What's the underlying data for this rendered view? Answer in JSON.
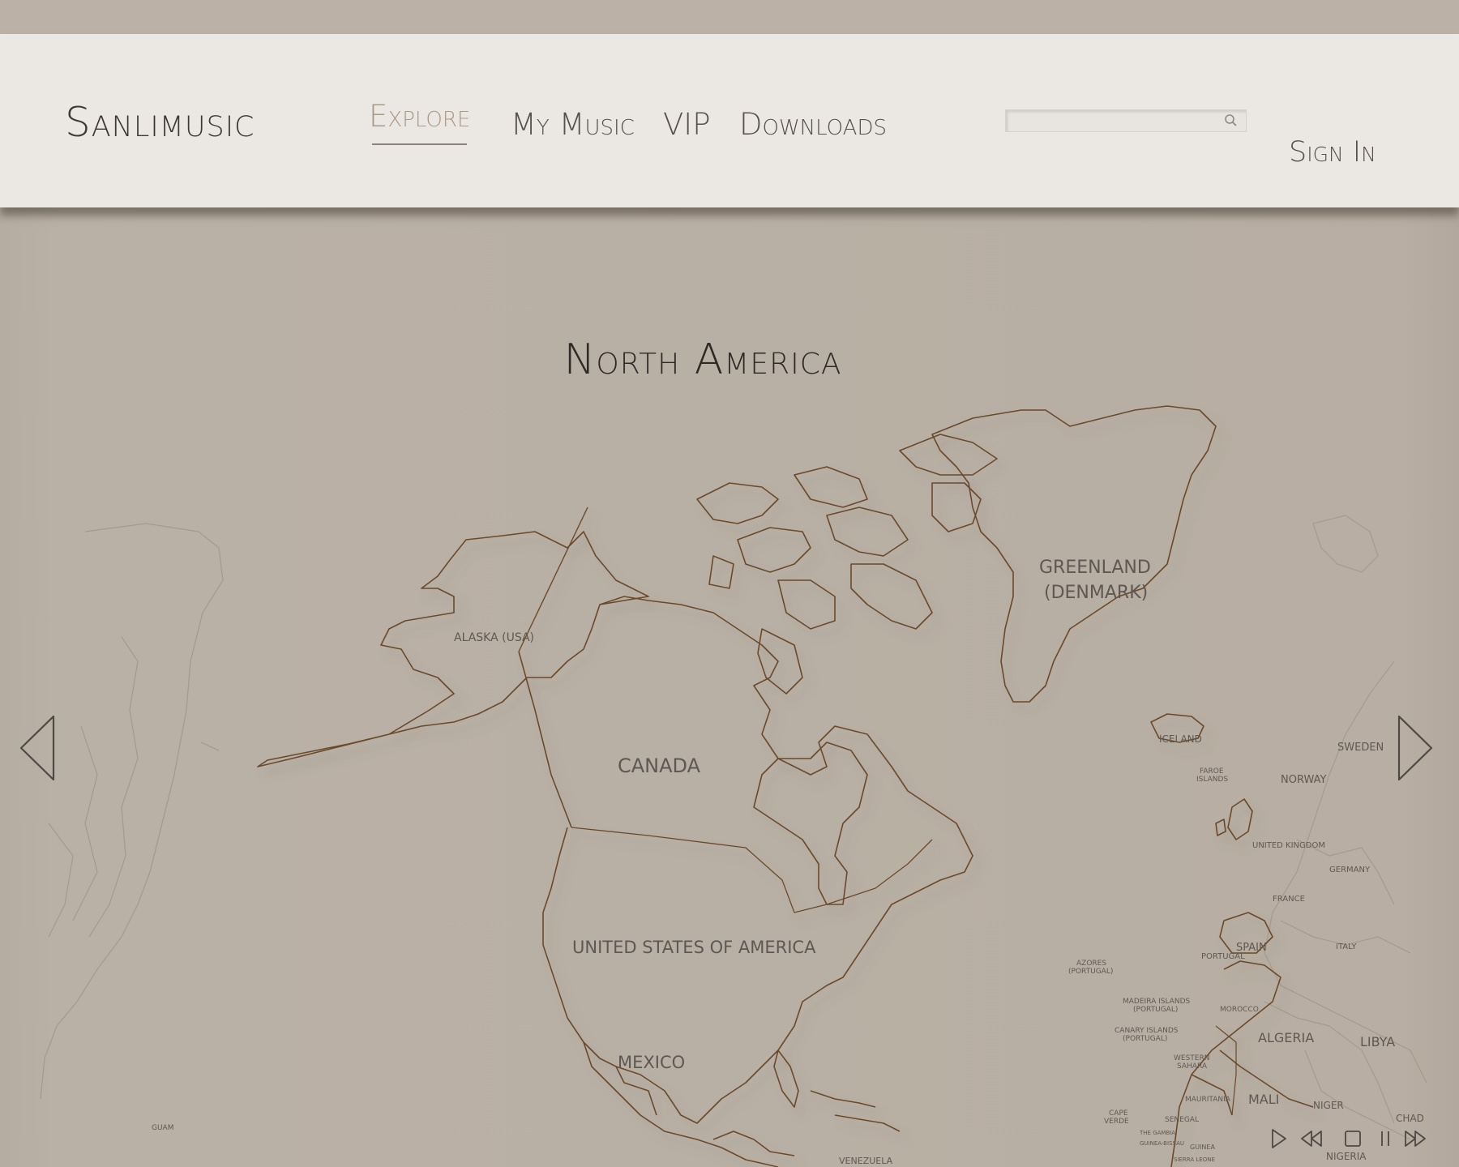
{
  "app": {
    "brand": "Sanlimusic"
  },
  "nav": {
    "items": [
      "Explore",
      "My Music",
      "VIP",
      "Downloads"
    ],
    "active": "Explore"
  },
  "search": {
    "value": "",
    "placeholder": ""
  },
  "account": {
    "signin_label": "Sign In"
  },
  "map": {
    "title": "North America",
    "labels": {
      "alaska": "ALASKA (USA)",
      "canada": "CANADA",
      "usa": "UNITED STATES OF AMERICA",
      "mexico": "MEXICO",
      "greenland_1": "GREENLAND",
      "greenland_2": "(DENMARK)",
      "iceland": "ICELAND",
      "faroe_1": "FAROE",
      "faroe_2": "ISLANDS",
      "norway": "NORWAY",
      "sweden": "SWEDEN",
      "spain": "SPAIN",
      "portugal": "PORTUGAL",
      "france": "FRANCE",
      "germany": "GERMANY",
      "united_kingdom": "UNITED KINGDOM",
      "italy": "ITALY",
      "azores_1": "AZORES",
      "azores_2": "(PORTUGAL)",
      "madeira_1": "MADEIRA ISLANDS",
      "madeira_2": "(PORTUGAL)",
      "canary_1": "CANARY ISLANDS",
      "canary_2": "(PORTUGAL)",
      "western_sahara_1": "WESTERN",
      "western_sahara_2": "SAHARA",
      "morocco": "MOROCCO",
      "algeria": "ALGERIA",
      "libya": "LIBYA",
      "mali": "MALI",
      "mauritania": "MAURITANIA",
      "niger": "NIGER",
      "chad": "CHAD",
      "nigeria": "NIGERIA",
      "senegal": "SENEGAL",
      "cape_verde_1": "CAPE",
      "cape_verde_2": "VERDE",
      "the_gambia": "THE GAMBIA",
      "guinea_bissau": "GUINEA-BISSAU",
      "guinea": "GUINEA",
      "sierra_leone": "SIERRA LEONE",
      "venezuela": "VENEZUELA",
      "guam": "GUAM"
    }
  },
  "colors": {
    "outline": "#6b4a2b",
    "faint": "#a39788",
    "text": "#3a3530",
    "accent_active": "#a99a86"
  },
  "icons": {
    "prev": "chevron-left-icon",
    "next": "chevron-right-icon",
    "search": "search-icon",
    "play": "play-icon",
    "rewind": "rewind-icon",
    "stop": "stop-icon",
    "pause": "pause-icon",
    "forward": "fast-forward-icon"
  }
}
